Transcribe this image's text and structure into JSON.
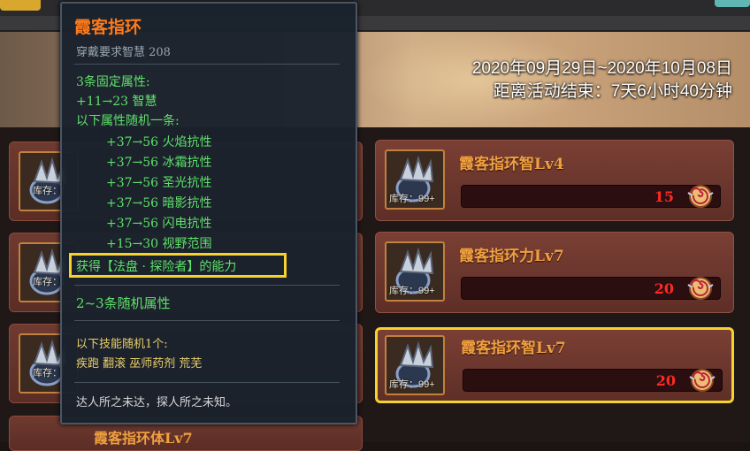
{
  "event": {
    "date_range": "2020年09月29日~2020年10月08日",
    "countdown": "距离活动结束：7天6小时40分钟"
  },
  "tooltip": {
    "title": "霞客指环",
    "requirement": "穿戴要求智慧 208",
    "fixed_header": "3条固定属性:",
    "fixed_stat": "+11→23 智慧",
    "random_header": "以下属性随机一条:",
    "random_stats": [
      "+37→56 火焰抗性",
      "+37→56 冰霜抗性",
      "+37→56 圣光抗性",
      "+37→56 暗影抗性",
      "+37→56 闪电抗性",
      "+15→30 视野范围"
    ],
    "special": "获得【法盘 · 探险者】的能力",
    "extra_random": "2~3条随机属性",
    "skill_header": "以下技能随机1个:",
    "skills": "疾跑 翻滚 巫师药剂 荒芜",
    "flavor": "达人所之未达，探人所之未知。"
  },
  "items": [
    {
      "name": "霞客指环智Lv4",
      "stock": "库存：99+",
      "price": "15"
    },
    {
      "name": "霞客指环力Lv7",
      "stock": "库存：99+",
      "price": "20"
    },
    {
      "name": "霞客指环智Lv7",
      "stock": "库存：99+",
      "price": "20"
    }
  ],
  "left_items": [
    {
      "stock": "库存："
    },
    {
      "stock": "库存："
    },
    {
      "stock": "库存："
    }
  ],
  "bottom_item": {
    "name": "霞客指环体Lv7"
  },
  "colors": {
    "name": "#f0a040",
    "price": "#ff2a22",
    "tooltip_title": "#ff7a1a",
    "tooltip_stat": "#5ee06a",
    "highlight": "#f5d22e"
  }
}
